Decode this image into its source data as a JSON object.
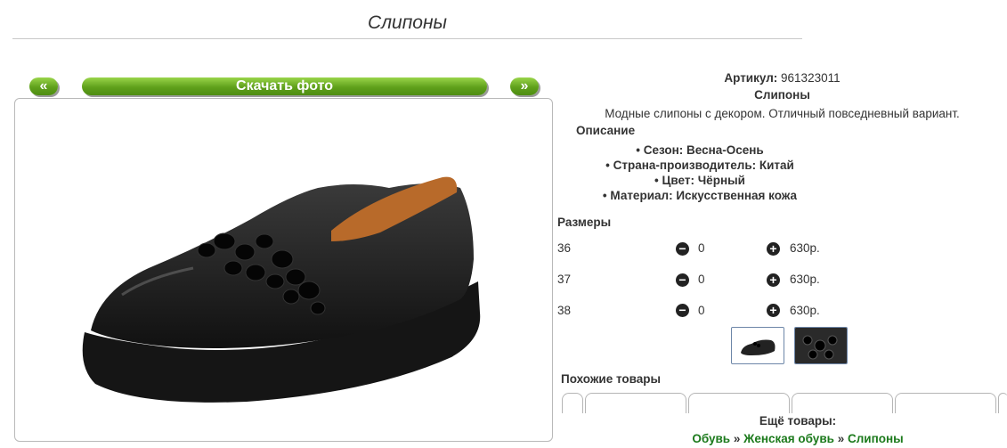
{
  "page": {
    "title": "Слипоны"
  },
  "nav": {
    "prev_label": "«",
    "download_label": "Скачать фото",
    "next_label": "»"
  },
  "product": {
    "sku_label": "Артикул:",
    "sku_value": "961323011",
    "name": "Слипоны",
    "description": "Модные слипоны с декором. Отличный повседневный вариант.",
    "description_heading": "Описание",
    "specs": [
      "Сезон: Весна-Осень",
      "Страна-производитель: Китай",
      "Цвет: Чёрный",
      "Материал: Искусственная кожа"
    ]
  },
  "sizes": {
    "heading": "Размеры",
    "rows": [
      {
        "size": "36",
        "qty": "0",
        "price": "630р."
      },
      {
        "size": "37",
        "qty": "0",
        "price": "630р."
      },
      {
        "size": "38",
        "qty": "0",
        "price": "630р."
      }
    ]
  },
  "similar": {
    "heading": "Похожие товары"
  },
  "more": {
    "label": "Ещё товары:",
    "crumbs": [
      "Обувь",
      "Женская обувь",
      "Слипоны"
    ],
    "separator": "»"
  }
}
